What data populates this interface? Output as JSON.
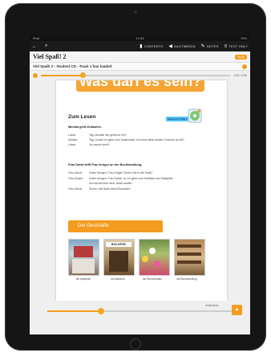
{
  "status": {
    "left": "iPad",
    "center": "12:34",
    "right": "74%"
  },
  "toolbar": {
    "items": [
      {
        "label": "CONTENTS",
        "icon": "book-icon"
      },
      {
        "label": "MULTIMEDIA",
        "icon": "speaker-icon"
      },
      {
        "label": "NOTES",
        "icon": "pencil-icon"
      },
      {
        "label": "TEXT ONLY",
        "icon": "text-icon"
      }
    ]
  },
  "title": "Viel Spaß! 2",
  "page_button": "Pg 85",
  "audio": {
    "text": "Viel Spaß! 2 - Student CD - Track 1 has loaded",
    "time": "0:00 / 0:58",
    "progress": 0.22
  },
  "page": {
    "banner": "Was darf es sein?",
    "section": "Zum Lesen",
    "badge": "Student CD Track 1",
    "sub1": "Monika geht einkaufen.",
    "dialogue1": [
      {
        "speaker": "Lukas:",
        "line": "Tag, Monika! Wo gehst du hin?"
      },
      {
        "speaker": "Monika:",
        "line": "Tag, Lukas! Ich gehe zum Supermarkt. Ich muss Milch kaufen. Kommst du mit?"
      },
      {
        "speaker": "Lukas:",
        "line": "Ja, warum nicht?"
      }
    ],
    "sub2": "Frau David trifft Frau Krüger an der Buchhandlung.",
    "dialogue2": [
      {
        "speaker": "Frau David:",
        "line": "Guten Morgen, Frau Krüger! Gehen Sie in die Stadt?"
      },
      {
        "speaker": "Frau Krüger:",
        "line": "Guten Morgen, Frau David! Ja, ich gehe zum Kaufhaus am Stadtplatz."
      },
      {
        "speaker": "",
        "line": "Ich möchte eine neue Jacke kaufen."
      },
      {
        "speaker": "Frau David:",
        "line": "Schön. Viel Spaß beim Einkaufen!"
      }
    ],
    "ribbon": "Der Geschäfte",
    "captions": [
      "die Apotheke",
      "die Bäckerei",
      "der Blumenladen",
      "die Buchhandlung"
    ],
    "bakery_sign": "BÄCKEREI"
  },
  "bottom": {
    "label": "Seitenleiste",
    "progress": 0.28,
    "fab_icon": "arrow-up-icon"
  },
  "colors": {
    "accent": "#f39c1f",
    "frame": "#151515"
  }
}
